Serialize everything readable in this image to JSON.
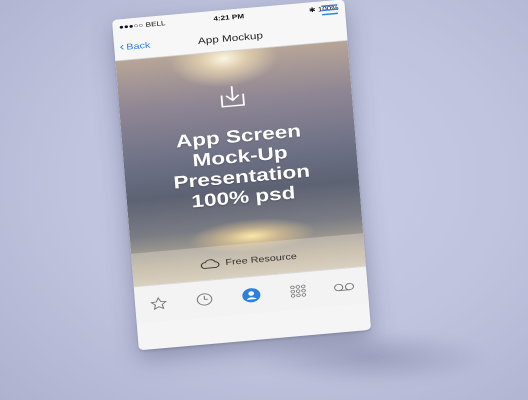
{
  "status": {
    "carrier": "●●●○○ BELL",
    "time": "4:21 PM",
    "battery": "✱ 100%"
  },
  "nav": {
    "back_label": "Back",
    "title": "App Mockup",
    "menu_icon": "hamburger-menu-icon"
  },
  "hero": {
    "icon": "download-icon",
    "lines": [
      "App Screen",
      "Mock-Up",
      "Presentation",
      "100% psd"
    ]
  },
  "resource": {
    "icon": "cloud-icon",
    "label": "Free Resource"
  },
  "tabs": [
    {
      "name": "favorites",
      "icon": "star-icon"
    },
    {
      "name": "recents",
      "icon": "clock-icon"
    },
    {
      "name": "contacts",
      "icon": "person-icon",
      "active": true
    },
    {
      "name": "keypad",
      "icon": "keypad-icon"
    },
    {
      "name": "voicemail",
      "icon": "voicemail-icon"
    }
  ],
  "colors": {
    "accent": "#2d7fe0",
    "background": "#c4c8e2"
  }
}
